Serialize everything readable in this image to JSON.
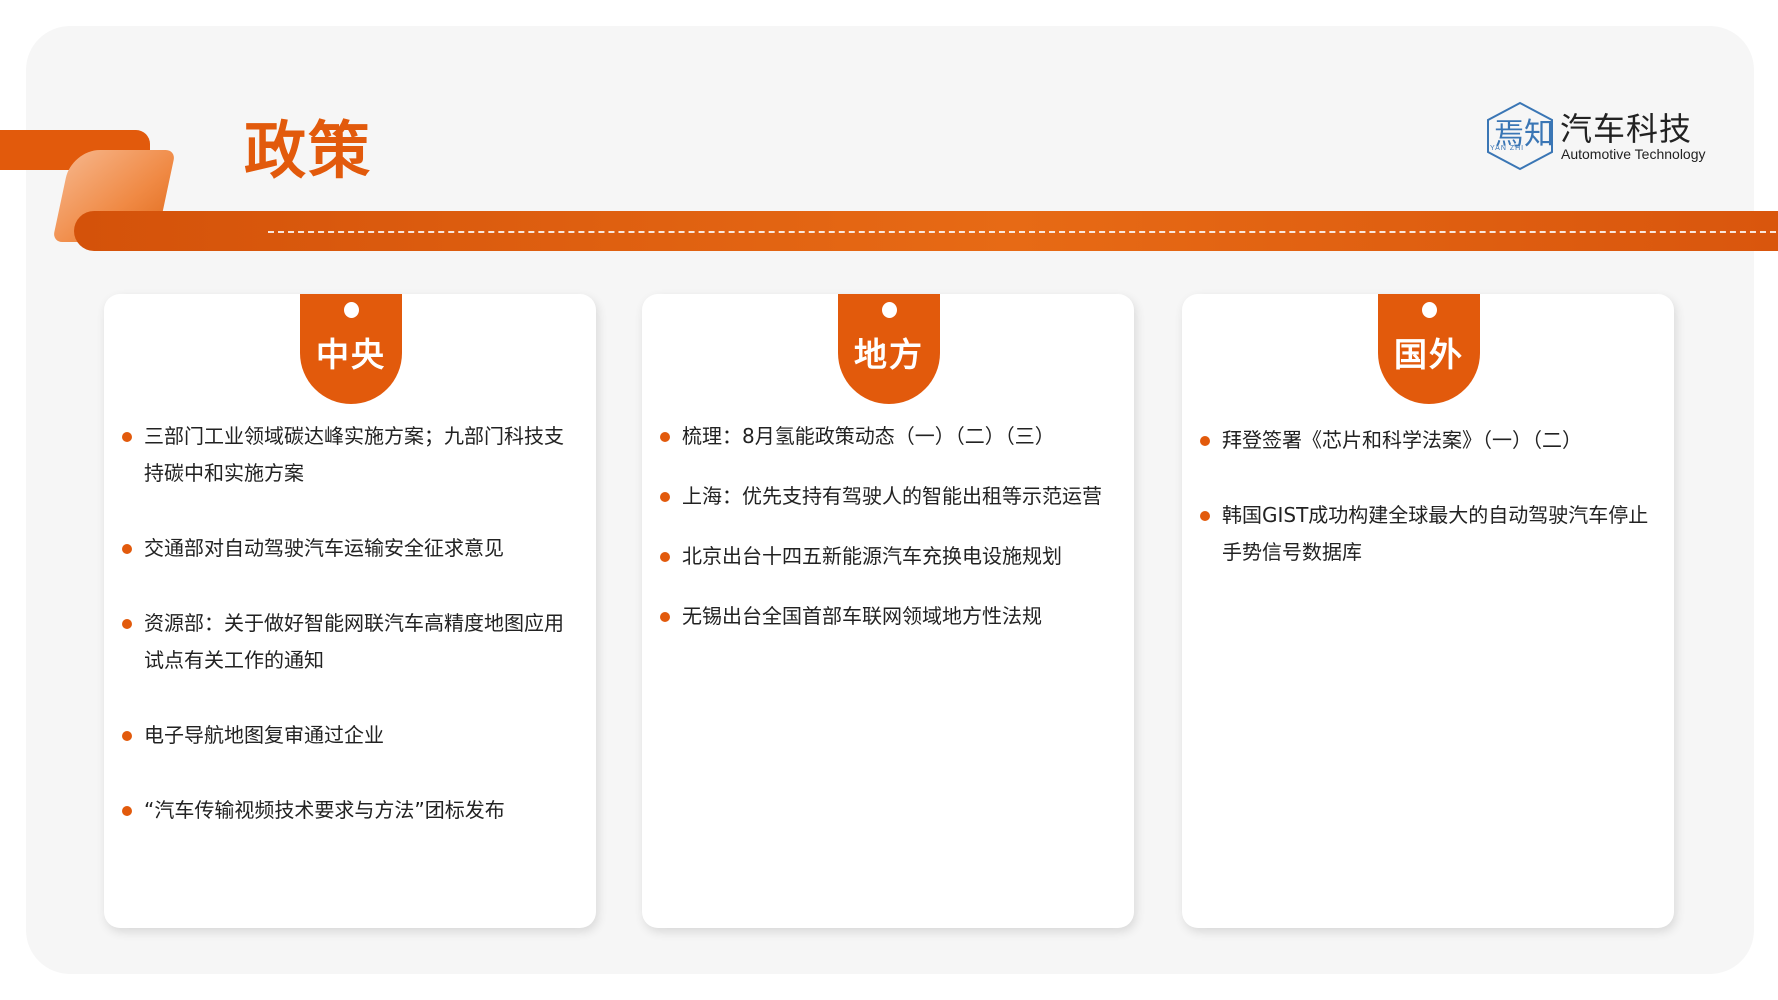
{
  "page": {
    "title": "政策",
    "accent_color": "#e25a0c"
  },
  "logo": {
    "cn": "汽车科技",
    "en": "Automotive Technology",
    "mark_text": "YAN ZHI",
    "mark_glyphs": "焉知"
  },
  "watermark": "焉知",
  "panels": [
    {
      "label": "中央",
      "items": [
        "三部门工业领域碳达峰实施方案；九部门科技支持碳中和实施方案",
        "交通部对自动驾驶汽车运输安全征求意见",
        "资源部：关于做好智能网联汽车高精度地图应用试点有关工作的通知",
        "电子导航地图复审通过企业",
        "“汽车传输视频技术要求与方法”团标发布"
      ]
    },
    {
      "label": "地方",
      "items": [
        "梳理：8月氢能政策动态（一）（二）（三）",
        "上海：优先支持有驾驶人的智能出租等示范运营",
        "北京出台十四五新能源汽车充换电设施规划",
        "无锡出台全国首部车联网领域地方性法规"
      ]
    },
    {
      "label": "国外",
      "items": [
        "拜登签署《芯片和科学法案》（一）（二）",
        "韩国GIST成功构建全球最大的自动驾驶汽车停止手势信号数据库"
      ]
    }
  ]
}
